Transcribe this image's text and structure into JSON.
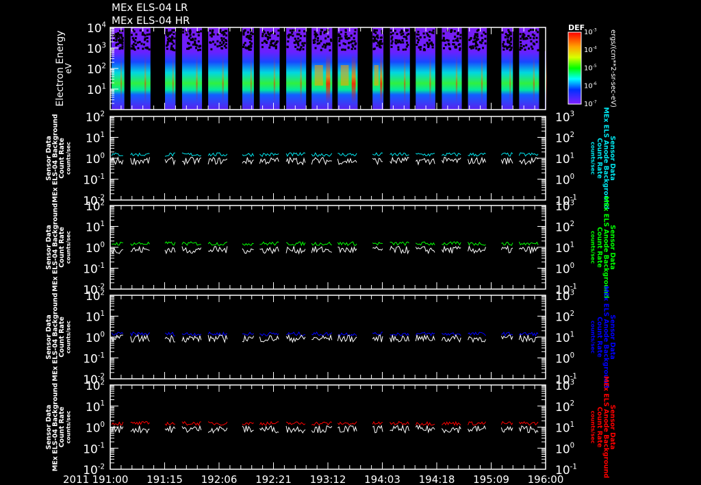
{
  "titles": [
    "MEx ELS-04 LR",
    "MEx ELS-04 HR"
  ],
  "year_label": "2011",
  "time_axis": {
    "start_hours": 0,
    "end_hours": 120,
    "tick_labels": [
      "191:00",
      "191:15",
      "192:06",
      "192:21",
      "193:12",
      "194:03",
      "194:18",
      "195:09",
      "196:00"
    ]
  },
  "colors": {
    "panel1": "#00e5ee",
    "panel2": "#00ff00",
    "panel3": "#0000ff",
    "panel4": "#ff0000",
    "white": "#ffffff"
  },
  "chart_data": [
    {
      "type": "heatmap",
      "name": "spectrogram",
      "ylabel": "Electron Energy",
      "yunit": "eV",
      "yscale": "log",
      "ylim_exp": [
        0,
        4
      ],
      "ytick_exps": [
        4,
        3,
        2,
        1
      ],
      "colorbar": {
        "label": "DEF",
        "unit": "ergs/(cm**2-sr-sec-eV)",
        "tick_exps": [
          -3,
          -4,
          -5,
          -6,
          -7
        ]
      },
      "data_segments_hours": [
        [
          0.4,
          3.9
        ],
        [
          5.6,
          11.1
        ],
        [
          15.1,
          18.0
        ],
        [
          19.8,
          25.3
        ],
        [
          27.0,
          32.5
        ],
        [
          36.4,
          39.6
        ],
        [
          41.2,
          46.7
        ],
        [
          48.5,
          54.0
        ],
        [
          55.5,
          61.2
        ],
        [
          62.7,
          68.2
        ],
        [
          72.3,
          75.3
        ],
        [
          77.1,
          82.6
        ],
        [
          84.2,
          89.6
        ],
        [
          91.4,
          96.9
        ],
        [
          98.6,
          103.8
        ],
        [
          107.8,
          111.0
        ],
        [
          112.7,
          118.2
        ],
        [
          119.8,
          120
        ]
      ],
      "peak_energy_eV": 20,
      "intense_segments": [
        8,
        9,
        10
      ]
    },
    {
      "type": "line",
      "name": "panel1",
      "left_label": [
        "Sensor Data",
        "MEx ELS-04 Background",
        "Count Rate",
        "counts/sec"
      ],
      "right_label": [
        "Sensor Data",
        "MEx ELS Anode Background",
        "Count Rate",
        "counts/sec"
      ],
      "yscale": "log",
      "left_exps": [
        2,
        1,
        0,
        -1,
        -2
      ],
      "right_exps": [
        3,
        2,
        1,
        0,
        -1
      ],
      "series": [
        {
          "name": "anode",
          "color": "#00e5ee",
          "level": 1.5
        },
        {
          "name": "els-04",
          "color": "#ffffff",
          "level": 0.75
        }
      ]
    },
    {
      "type": "line",
      "name": "panel2",
      "left_label": [
        "Sensor Data",
        "MEx ELS-04 Background",
        "Count Rate",
        "counts/sec"
      ],
      "right_label": [
        "Sensor Data",
        "MEx ELS Anode Background",
        "Count Rate",
        "counts/sec"
      ],
      "yscale": "log",
      "left_exps": [
        2,
        1,
        0,
        -1,
        -2
      ],
      "right_exps": [
        3,
        2,
        1,
        0,
        -1
      ],
      "series": [
        {
          "name": "anode",
          "color": "#00ff00",
          "level": 1.5
        },
        {
          "name": "els-04",
          "color": "#ffffff",
          "level": 0.75
        }
      ]
    },
    {
      "type": "line",
      "name": "panel3",
      "left_label": [
        "Sensor Data",
        "MEx ELS-04 Background",
        "Count Rate",
        "counts/sec"
      ],
      "right_label": [
        "Sensor Data",
        "MEx ELS Anode Background",
        "Count Rate",
        "counts/sec"
      ],
      "yscale": "log",
      "left_exps": [
        2,
        1,
        0,
        -1,
        -2
      ],
      "right_exps": [
        3,
        2,
        1,
        0,
        -1
      ],
      "series": [
        {
          "name": "anode",
          "color": "#0000ff",
          "level": 1.4
        },
        {
          "name": "els-04",
          "color": "#ffffff",
          "level": 0.85
        }
      ]
    },
    {
      "type": "line",
      "name": "panel4",
      "left_label": [
        "Sensor Data",
        "MEx ELS-04 Background",
        "Count Rate",
        "counts/sec"
      ],
      "right_label": [
        "Sensor Data",
        "MEx ELS Anode Background",
        "Count Rate",
        "counts/sec"
      ],
      "yscale": "log",
      "left_exps": [
        2,
        1,
        0,
        -1,
        -2
      ],
      "right_exps": [
        3,
        2,
        1,
        0,
        -1
      ],
      "series": [
        {
          "name": "anode",
          "color": "#ff0000",
          "level": 1.5
        },
        {
          "name": "els-04",
          "color": "#ffffff",
          "level": 0.8
        }
      ]
    }
  ]
}
